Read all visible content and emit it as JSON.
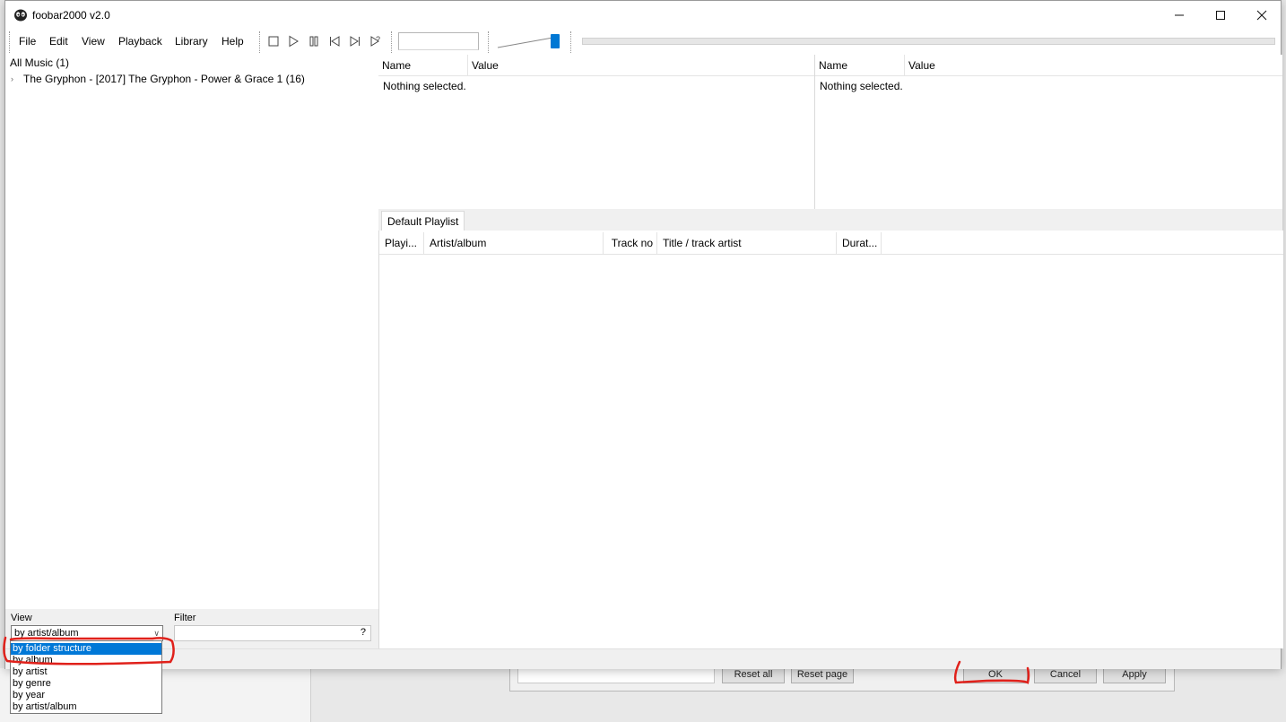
{
  "window": {
    "title": "foobar2000 v2.0",
    "controls": [
      "minimize",
      "maximize",
      "close"
    ]
  },
  "menu": [
    "File",
    "Edit",
    "View",
    "Playback",
    "Library",
    "Help"
  ],
  "toolbar_icons": [
    "stop-icon",
    "play-icon",
    "pause-icon",
    "previous-icon",
    "next-icon",
    "random-icon"
  ],
  "volume_level": 0.85,
  "library": {
    "root": "All Music (1)",
    "items": [
      "The Gryphon - [2017] The Gryphon - Power & Grace 1 (16)"
    ],
    "view_label": "View",
    "view_value": "by artist/album",
    "filter_label": "Filter",
    "filter_help": "?",
    "view_options": [
      "by folder structure",
      "by album",
      "by artist",
      "by genre",
      "by year",
      "by artist/album"
    ],
    "selected_option": "by folder structure"
  },
  "properties": [
    {
      "columns": [
        "Name",
        "Value"
      ],
      "message": "Nothing selected."
    },
    {
      "columns": [
        "Name",
        "Value"
      ],
      "message": "Nothing selected."
    }
  ],
  "playlist": {
    "tab": "Default Playlist",
    "columns": [
      "Playi...",
      "Artist/album",
      "Track no",
      "Title / track artist",
      "Durat..."
    ]
  },
  "background_dialog": {
    "buttons": [
      "Reset all",
      "Reset page",
      "OK",
      "Cancel",
      "Apply"
    ]
  },
  "colors": {
    "selection": "#0078d7",
    "annotation": "#e0211b",
    "accent": "#0078d4"
  }
}
